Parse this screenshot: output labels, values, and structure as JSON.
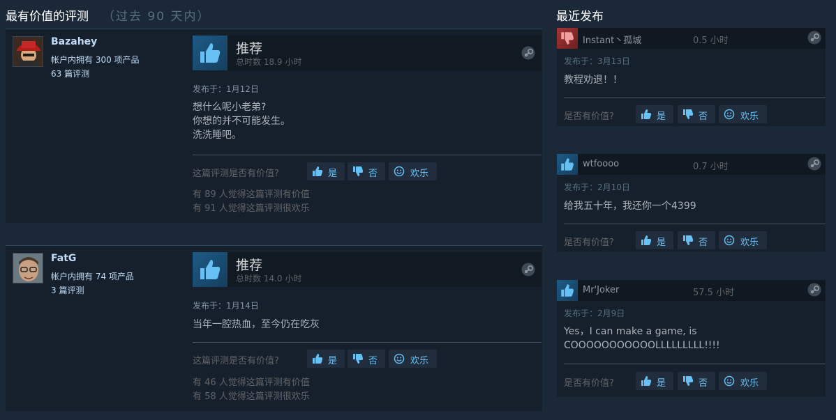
{
  "most_helpful": {
    "title": "最有价值的评测",
    "subtitle": "（过去 90 天内）",
    "reviews": [
      {
        "author": "Bazahey",
        "products": "帐户内拥有 300 项产品",
        "review_count": "63 篇评测",
        "recommendation": "推荐",
        "hours": "总时数 18.9 小时",
        "posted": "发布于：1月12日",
        "text_lines": [
          "想什么呢小老弟?",
          "你想的并不可能发生。",
          "洗洗睡吧。"
        ],
        "helpful_question": "这篇评测是否有价值?",
        "yes_label": "是",
        "no_label": "否",
        "funny_label": "欢乐",
        "helpful_count": "有 89 人觉得这篇评测有价值",
        "funny_count": "有 91 人觉得这篇评测很欢乐"
      },
      {
        "author": "FatG",
        "products": "帐户内拥有 74 项产品",
        "review_count": "3 篇评测",
        "recommendation": "推荐",
        "hours": "总时数 14.0 小时",
        "posted": "发布于：1月14日",
        "text_lines": [
          "当年一腔热血，至今仍在吃灰"
        ],
        "helpful_question": "这篇评测是否有价值?",
        "yes_label": "是",
        "no_label": "否",
        "funny_label": "欢乐",
        "helpful_count": "有 46 人觉得这篇评测有价值",
        "funny_count": "有 58 人觉得这篇评测很欢乐"
      }
    ]
  },
  "recent": {
    "title": "最近发布",
    "reviews": [
      {
        "vote": "down",
        "author": "Instant丶孤城",
        "hours": "0.5 小时",
        "posted": "发布于：3月13日",
        "text_lines": [
          "教程劝退！！"
        ],
        "helpful_question": "是否有价值?",
        "yes_label": "是",
        "no_label": "否",
        "funny_label": "欢乐"
      },
      {
        "vote": "up",
        "author": "wtfoooo",
        "hours": "0.7 小时",
        "posted": "发布于：2月10日",
        "text_lines": [
          "给我五十年，我还你一个4399"
        ],
        "helpful_question": "是否有价值?",
        "yes_label": "是",
        "no_label": "否",
        "funny_label": "欢乐"
      },
      {
        "vote": "up",
        "author": "Mr'Joker",
        "hours": "57.5 小时",
        "posted": "发布于：2月9日",
        "text_lines": [
          "Yes，I can make a game, is",
          "COOOOOOOOOOOLLLLLLLLL!!!!"
        ],
        "helpful_question": "是否有价值?",
        "yes_label": "是",
        "no_label": "否",
        "funny_label": "欢乐"
      }
    ]
  }
}
